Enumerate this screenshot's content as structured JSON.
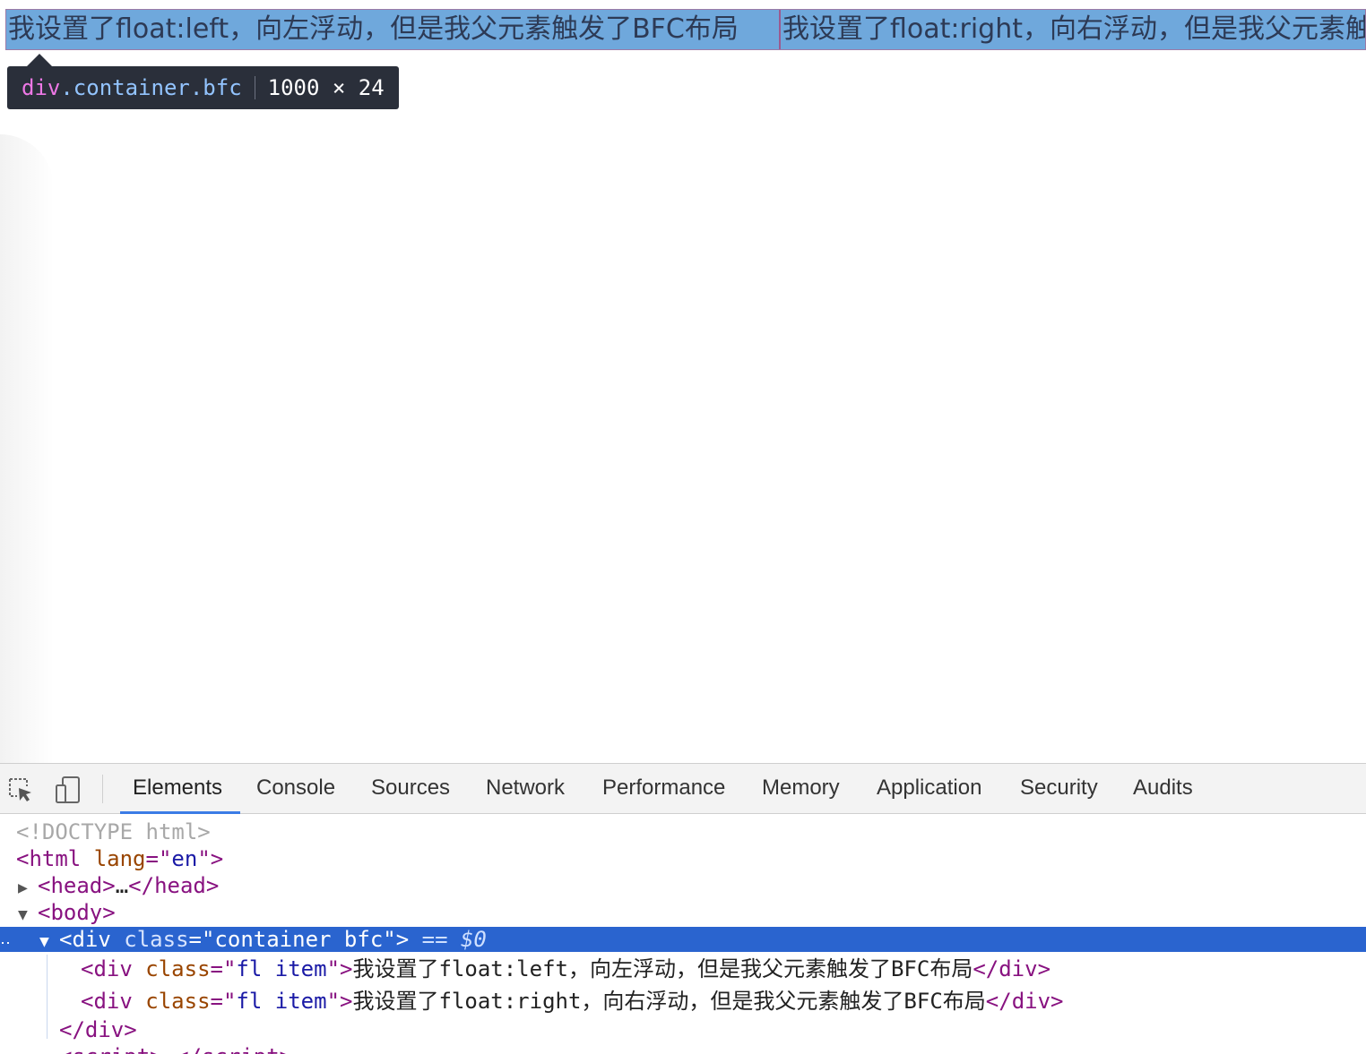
{
  "page": {
    "items": [
      {
        "text": "我设置了float:left，向左浮动，但是我父元素触发了BFC布局"
      },
      {
        "text": "我设置了float:right，向右浮动，但是我父元素触发了BFC布局"
      }
    ]
  },
  "inspector_tooltip": {
    "tag": "div",
    "class_text": ".container.bfc",
    "size": "1000 × 24"
  },
  "devtools": {
    "tabs": [
      {
        "label": "Elements",
        "active": true
      },
      {
        "label": "Console"
      },
      {
        "label": "Sources"
      },
      {
        "label": "Network"
      },
      {
        "label": "Performance"
      },
      {
        "label": "Memory"
      },
      {
        "label": "Application"
      },
      {
        "label": "Security"
      },
      {
        "label": "Audits"
      }
    ],
    "dom": {
      "doctype": "<!DOCTYPE html>",
      "html_tag": "html",
      "html_attr": "lang",
      "html_val": "en",
      "head_tag": "head",
      "head_ellipsis": "…",
      "body_tag": "body",
      "div_tag": "div",
      "div_attr": "class",
      "div_val": "container bfc",
      "eq_label": "== $0",
      "child_attr": "class",
      "child_val": "fl item",
      "children": [
        "我设置了float:left，向左浮动，但是我父元素触发了BFC布局",
        "我设置了float:right，向右浮动，但是我父元素触发了BFC布局"
      ],
      "close_div": "div",
      "script_tag": "script"
    }
  },
  "colors": {
    "highlight": "#6fa8dc",
    "selected_row": "#2a64cf",
    "tab_underline": "#3b7ce6"
  }
}
